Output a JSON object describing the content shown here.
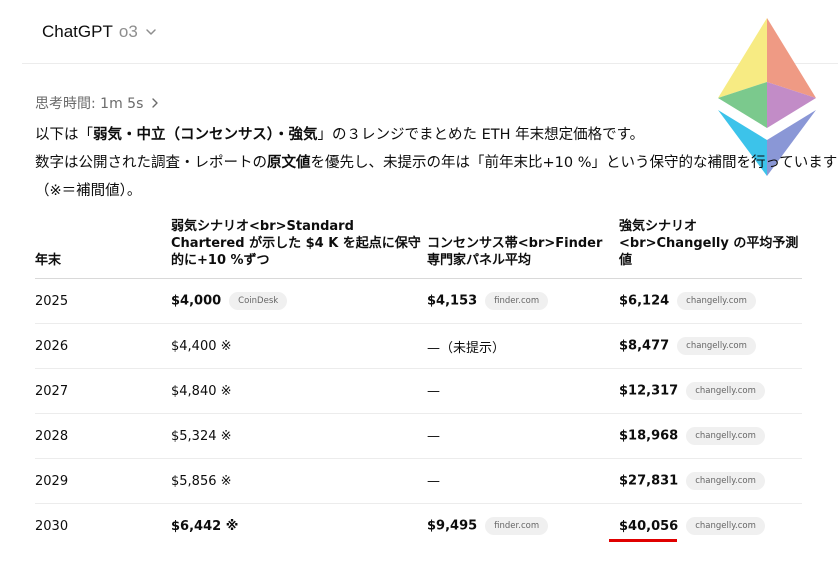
{
  "header": {
    "model_name": "ChatGPT",
    "model_variant": "o3"
  },
  "thinking": {
    "label": "思考時間: 1m 5s"
  },
  "intro": {
    "line1_a": "以下は「",
    "line1_b": "弱気・中立（コンセンサス）・強気",
    "line1_c": "」の３レンジでまとめた ETH 年末想定価格です。",
    "line2_a": "数字は公開された調査・レポートの",
    "line2_b": "原文値",
    "line2_c": "を優先し、未提示の年は「前年末比+10 %」という保守的な補間を行っています",
    "line3": "（※＝補間値）。"
  },
  "table": {
    "headers": {
      "year": "年末",
      "bear": "弱気シナリオ<br>Standard Chartered が示した $4 K を起点に保守的に+10 %ずつ",
      "consensus": "コンセンサス帯<br>Finder 専門家パネル平均",
      "bull": "強気シナリオ<br>Changelly の平均予測値"
    },
    "rows": [
      {
        "year": "2025",
        "bear": "$4,000",
        "bear_src": "CoinDesk",
        "cons": "$4,153",
        "cons_src": "finder.com",
        "bull": "$6,124",
        "bull_src": "changelly.com"
      },
      {
        "year": "2026",
        "bear": "$4,400 ※",
        "cons": "—（未提示）",
        "bull": "$8,477",
        "bull_src": "changelly.com"
      },
      {
        "year": "2027",
        "bear": "$4,840 ※",
        "cons": "—",
        "bull": "$12,317",
        "bull_src": "changelly.com"
      },
      {
        "year": "2028",
        "bear": "$5,324 ※",
        "cons": "—",
        "bull": "$18,968",
        "bull_src": "changelly.com"
      },
      {
        "year": "2029",
        "bear": "$5,856 ※",
        "cons": "—",
        "bull": "$27,831",
        "bull_src": "changelly.com"
      },
      {
        "year": "2030",
        "bear": "$6,442 ※",
        "cons": "$9,495",
        "cons_src": "finder.com",
        "bull": "$40,056",
        "bull_src": "changelly.com"
      }
    ]
  },
  "colors": {
    "highlight_underline": "#e00000"
  }
}
